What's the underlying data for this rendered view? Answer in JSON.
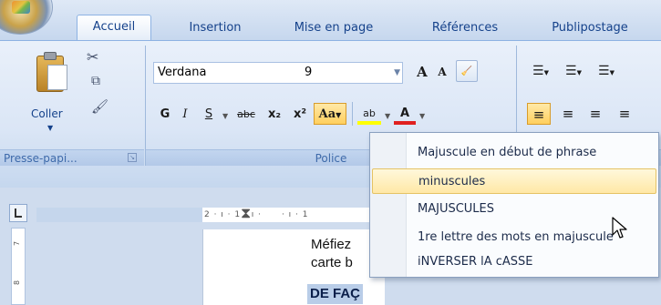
{
  "tabs": [
    {
      "label": "Accueil",
      "active": true
    },
    {
      "label": "Insertion",
      "active": false
    },
    {
      "label": "Mise en page",
      "active": false
    },
    {
      "label": "Références",
      "active": false
    },
    {
      "label": "Publipostage",
      "active": false
    }
  ],
  "clipboard": {
    "paste_label": "Coller",
    "group_label": "Presse-papi..."
  },
  "font": {
    "family": "Verdana",
    "size": "9",
    "group_label": "Police",
    "bold": "G",
    "italic": "I",
    "underline": "S",
    "strike": "abc",
    "subscript": "x₂",
    "superscript": "x²",
    "change_case": "Aa",
    "highlight": "ab",
    "font_color": "A",
    "grow": "A",
    "shrink": "A"
  },
  "change_case_menu": [
    {
      "label": "Majuscule en début de phrase",
      "hover": false
    },
    {
      "label": "minuscules",
      "hover": true
    },
    {
      "label": "MAJUSCULES",
      "hover": false
    },
    {
      "label": "1re lettre des mots en majuscule",
      "hover": false
    },
    {
      "label": "iNVERSER lA cASSE",
      "hover": false
    }
  ],
  "ruler": {
    "horizontal": "2 · ı · 1 · ı ·",
    "horizontal_right": "· ı · 1",
    "vertical_7": "7",
    "vertical_8": "8"
  },
  "document": {
    "line1": "Méfiez",
    "line2": "carte b",
    "highlighted": "DE FAÇ"
  },
  "colors": {
    "accent": "#15428b",
    "hover": "#ffe8a6",
    "ribbon": "#dbe6f6"
  }
}
